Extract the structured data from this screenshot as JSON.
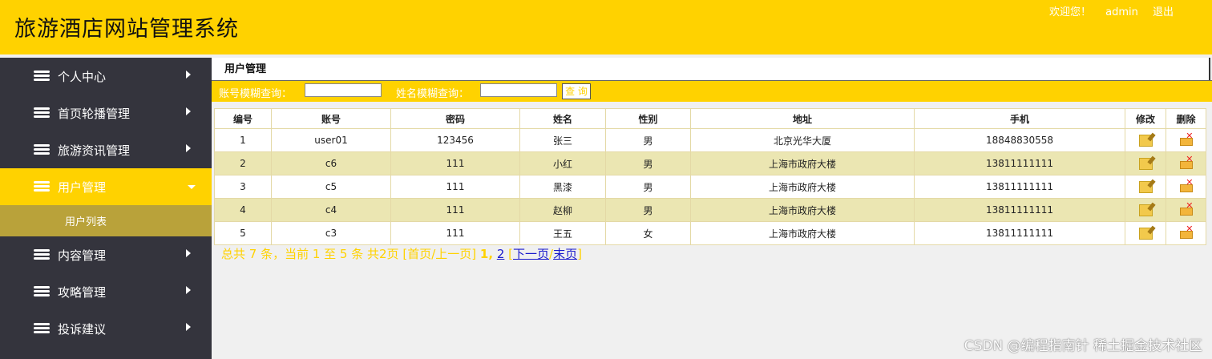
{
  "app": {
    "title": "旅游酒店网站管理系统"
  },
  "topnav": {
    "welcome": "欢迎您！",
    "user": "admin",
    "logout": "退出"
  },
  "sidebar": {
    "items": [
      {
        "label": "个人中心"
      },
      {
        "label": "首页轮播管理"
      },
      {
        "label": "旅游资讯管理"
      },
      {
        "label": "用户管理",
        "sub": "用户列表"
      },
      {
        "label": "内容管理"
      },
      {
        "label": "攻略管理"
      },
      {
        "label": "投诉建议"
      }
    ]
  },
  "page": {
    "title": "用户管理"
  },
  "search": {
    "account_label": "账号模糊查询：",
    "name_label": "姓名模糊查询：",
    "button": "查 询",
    "account_value": "",
    "name_value": ""
  },
  "table": {
    "headers": [
      "编号",
      "账号",
      "密码",
      "姓名",
      "性别",
      "地址",
      "手机",
      "修改",
      "删除"
    ],
    "rows": [
      [
        "1",
        "user01",
        "123456",
        "张三",
        "男",
        "北京光华大厦",
        "18848830558"
      ],
      [
        "2",
        "c6",
        "111",
        "小红",
        "男",
        "上海市政府大楼",
        "13811111111"
      ],
      [
        "3",
        "c5",
        "111",
        "黑漆",
        "男",
        "上海市政府大楼",
        "13811111111"
      ],
      [
        "4",
        "c4",
        "111",
        "赵柳",
        "男",
        "上海市政府大楼",
        "13811111111"
      ],
      [
        "5",
        "c3",
        "111",
        "王五",
        "女",
        "上海市政府大楼",
        "13811111111"
      ]
    ]
  },
  "pager": {
    "summary": "总共 7 条，当前 1 至 5 条 共2页",
    "first_prev": "[首页/上一页]",
    "page1": "1,",
    "page2": "2",
    "bracket_open": "[",
    "next": "下一页",
    "slash": "/",
    "last": "末页",
    "bracket_close": "]"
  },
  "watermark": "CSDN @编程指南针 稀土掘金技术社区",
  "colors": {
    "accent": "#ffd200",
    "sidebar": "#34343d",
    "row_alt": "#ebe6b2",
    "sub_menu": "#b9a23a"
  }
}
